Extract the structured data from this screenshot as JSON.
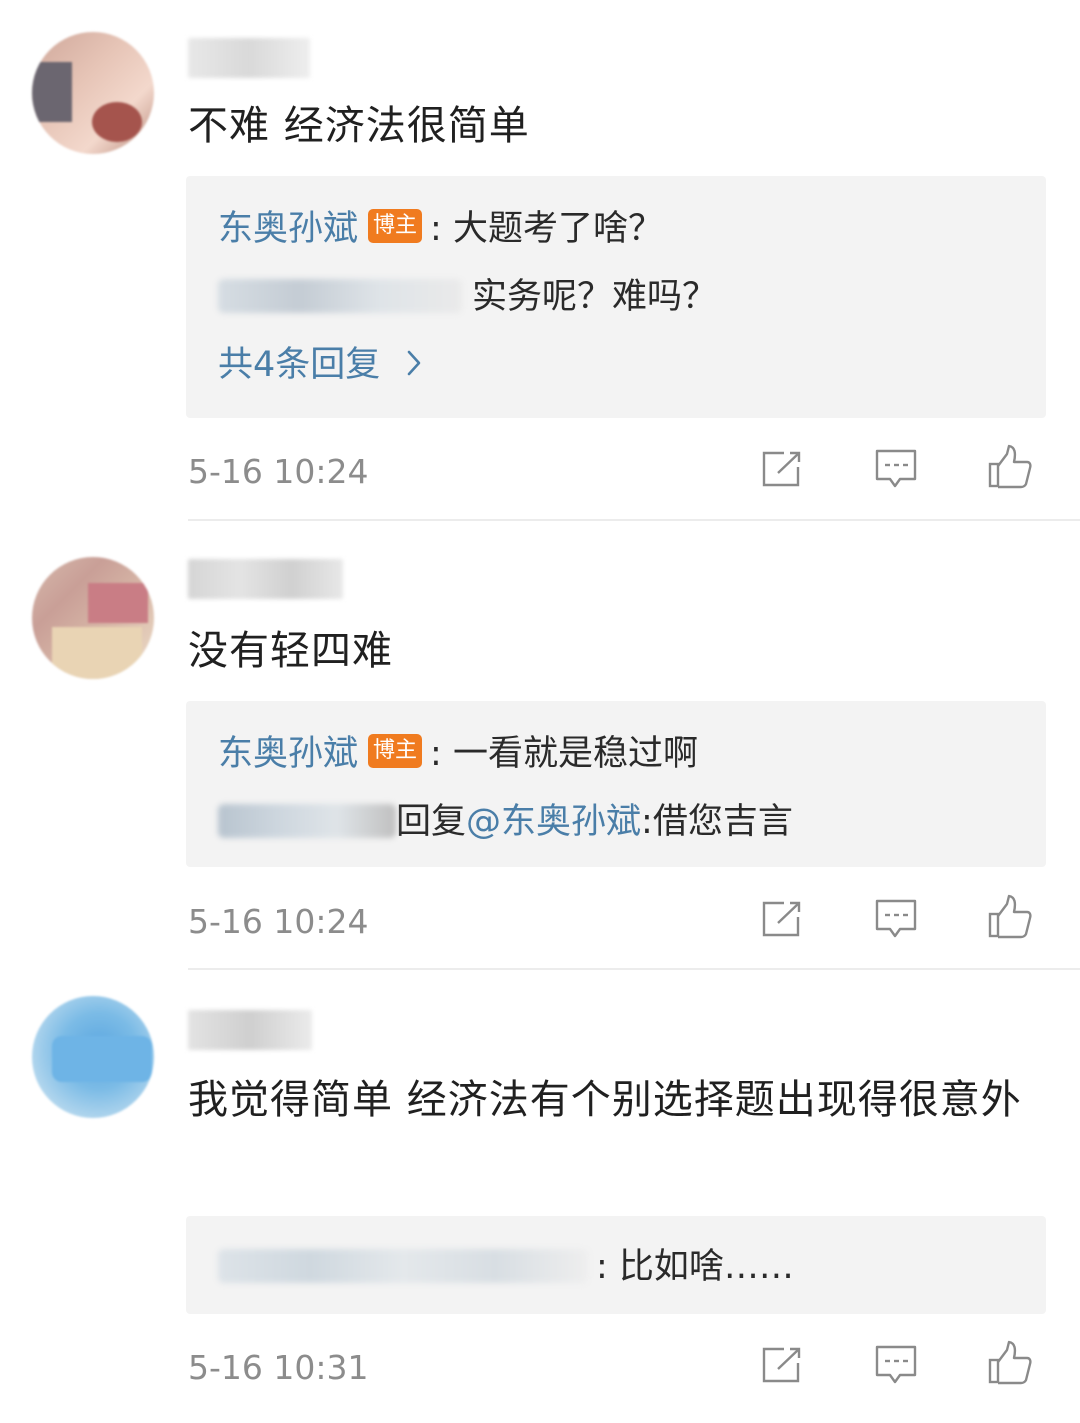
{
  "comments": [
    {
      "text": "不难 经济法很简单",
      "replies": [
        {
          "author": "东奥孙斌",
          "badge": "博主",
          "text": ": 大题考了啥？"
        },
        {
          "text": "实务呢？难吗？"
        }
      ],
      "more_replies": "共4条回复",
      "more_icon": "chevron-right-icon",
      "time": "5-16 10:24"
    },
    {
      "text": "没有轻四难",
      "replies": [
        {
          "author": "东奥孙斌",
          "badge": "博主",
          "text": ": 一看就是稳过啊"
        },
        {
          "reply_word": "回复",
          "mention": "@东奥孙斌",
          "text": ":借您吉言"
        }
      ],
      "time": "5-16 10:24"
    },
    {
      "text": "我觉得简单  经济法有个别选择题出现得很意外",
      "replies": [
        {
          "text": ": 比如啥……"
        }
      ],
      "time": "5-16 10:31"
    }
  ],
  "icons": {
    "share": "share-edit-icon",
    "comment": "comment-icon",
    "like": "thumbs-up-icon"
  },
  "colors": {
    "link_blue": "#4a7ea8",
    "badge_orange": "#f07b1f",
    "reply_bg": "#f3f3f3",
    "time_gray": "#8c8c8c"
  }
}
